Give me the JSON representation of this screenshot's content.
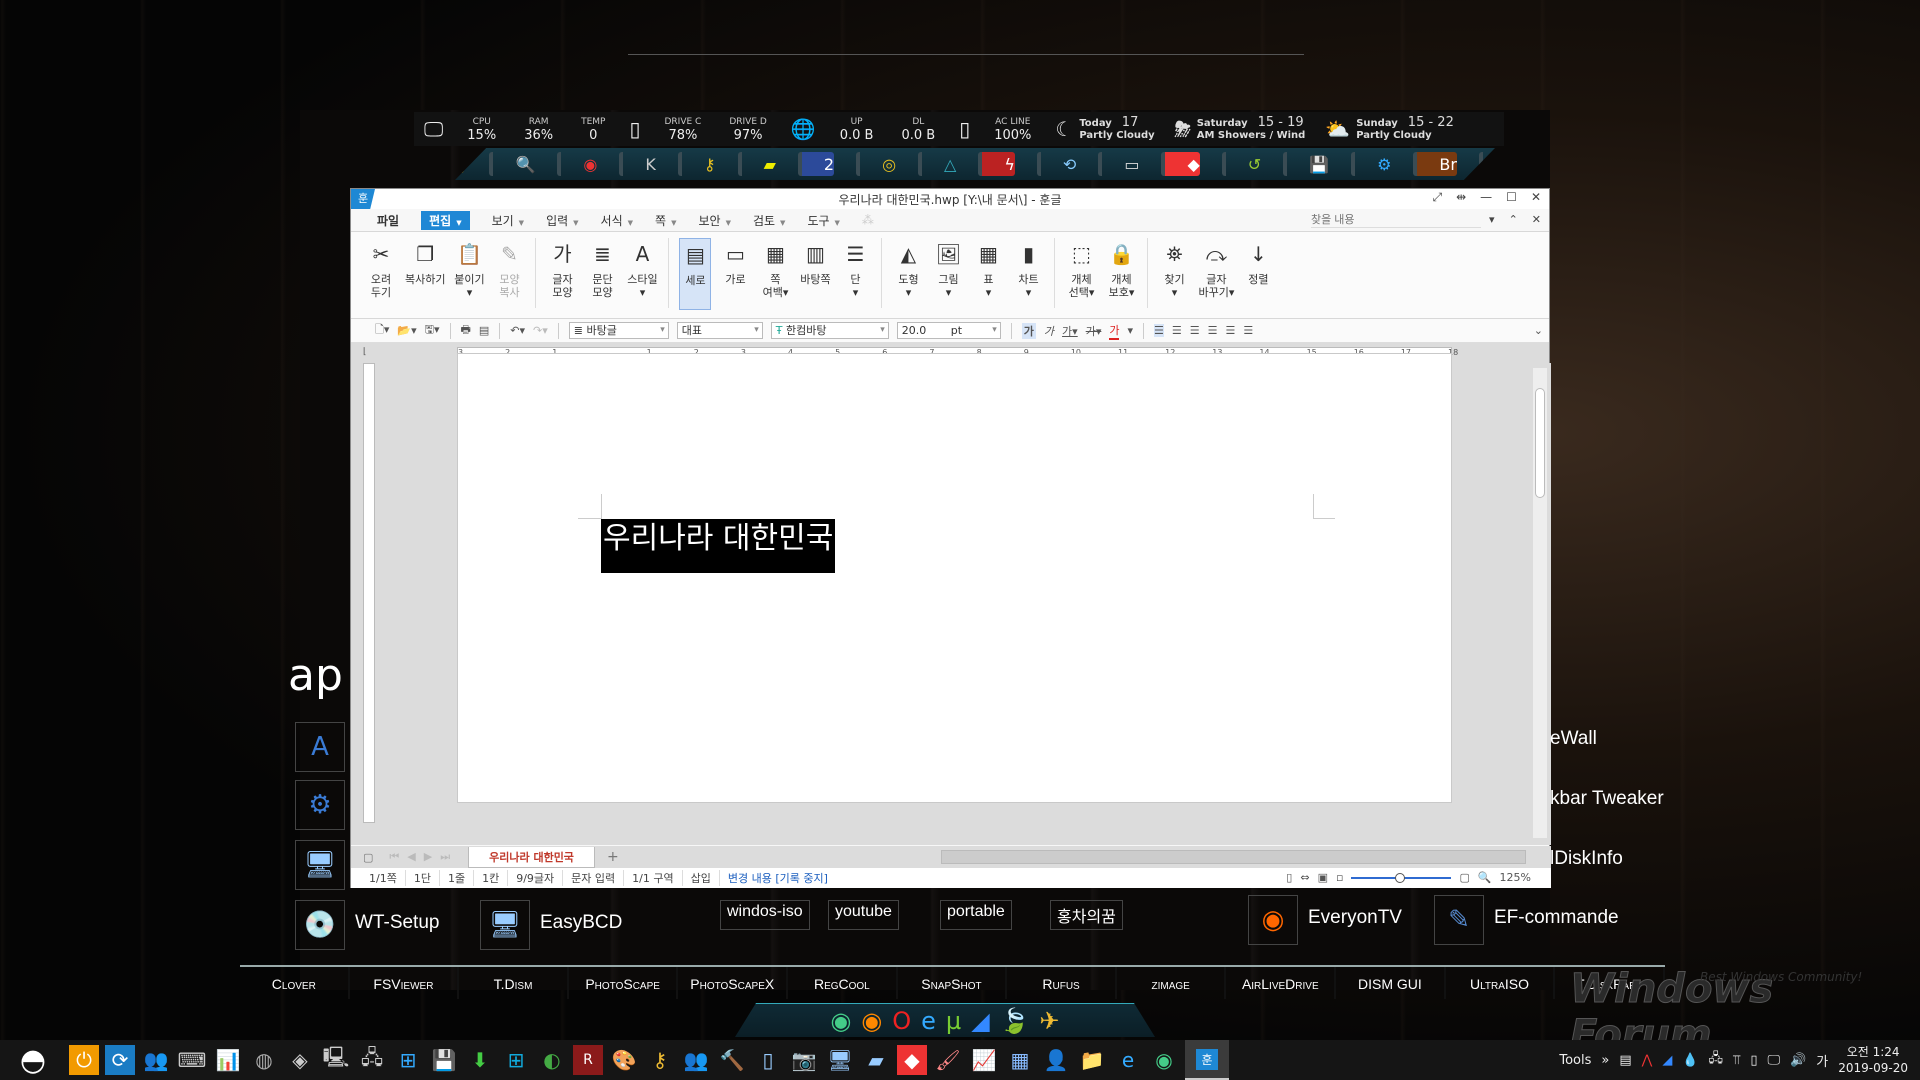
{
  "status_bar": {
    "cpu": {
      "label": "CPU",
      "value": "15%"
    },
    "ram": {
      "label": "RAM",
      "value": "36%"
    },
    "temp": {
      "label": "TEMP",
      "value": "0"
    },
    "drive_c": {
      "label": "DRIVE C",
      "value": "78%"
    },
    "drive_d": {
      "label": "DRIVE D",
      "value": "97%"
    },
    "up": {
      "label": "UP",
      "value": "0.0 B"
    },
    "dl": {
      "label": "DL",
      "value": "0.0 B"
    },
    "ac": {
      "label": "AC LINE",
      "value": "100%"
    },
    "weather": [
      {
        "day": "Today",
        "temp": "17",
        "desc": "Partly Cloudy",
        "icon": "moon-cloud-icon"
      },
      {
        "day": "Saturday",
        "temp": "15 - 19",
        "desc": "AM Showers / Wind",
        "icon": "sun-rain-icon"
      },
      {
        "day": "Sunday",
        "temp": "15 - 22",
        "desc": "Partly Cloudy",
        "icon": "sun-cloud-icon"
      }
    ]
  },
  "launcher_icons": [
    "internet-explorer-icon",
    "lock-gear-icon",
    "search-icon",
    "disk-refresh-icon",
    "k-icon",
    "key-icon",
    "pdf-icon",
    "number-2-icon",
    "disc-icon",
    "triangle-icon",
    "flash-icon",
    "backup-icon",
    "drive-icon",
    "anydesk-icon",
    "restore-icon",
    "floppy-icon",
    "gears-icon",
    "bridge-icon",
    "glove-icon",
    "settings-icon"
  ],
  "window": {
    "app_icon": "훈",
    "title": "우리나라 대한민국.hwp [Y:\\내 문서\\] - 훈글",
    "menu": [
      {
        "label": "파일"
      },
      {
        "label": "편집"
      },
      {
        "label": "보기"
      },
      {
        "label": "입력"
      },
      {
        "label": "서식"
      },
      {
        "label": "쪽"
      },
      {
        "label": "보안"
      },
      {
        "label": "검토"
      },
      {
        "label": "도구"
      }
    ],
    "search_placeholder": "찾을 내용",
    "ribbon": [
      {
        "label1": "오려",
        "label2": "두기",
        "icon": "✂"
      },
      {
        "label1": "복사하기",
        "label2": "",
        "icon": "❐"
      },
      {
        "label1": "붙이기",
        "label2": "▾",
        "icon": "📋"
      },
      {
        "label1": "모양",
        "label2": "복사",
        "icon": "✎"
      },
      {
        "label1": "글자",
        "label2": "모양",
        "icon": "가"
      },
      {
        "label1": "문단",
        "label2": "모양",
        "icon": "≣"
      },
      {
        "label1": "스타일",
        "label2": "▾",
        "icon": "A"
      },
      {
        "label1": "세로",
        "label2": "",
        "icon": "▤"
      },
      {
        "label1": "가로",
        "label2": "",
        "icon": "▭"
      },
      {
        "label1": "쪽",
        "label2": "여백▾",
        "icon": "▦"
      },
      {
        "label1": "바탕쪽",
        "label2": "",
        "icon": "▥"
      },
      {
        "label1": "단",
        "label2": "▾",
        "icon": "☰"
      },
      {
        "label1": "도형",
        "label2": "▾",
        "icon": "◭"
      },
      {
        "label1": "그림",
        "label2": "▾",
        "icon": "🖼"
      },
      {
        "label1": "표",
        "label2": "▾",
        "icon": "▦"
      },
      {
        "label1": "차트",
        "label2": "▾",
        "icon": "▮"
      },
      {
        "label1": "개체",
        "label2": "선택▾",
        "icon": "⬚"
      },
      {
        "label1": "개체",
        "label2": "보호▾",
        "icon": "🔒"
      },
      {
        "label1": "찾기",
        "label2": "▾",
        "icon": "⛯"
      },
      {
        "label1": "글자",
        "label2": "바꾸기▾",
        "icon": "⤼"
      },
      {
        "label1": "정렬",
        "label2": "",
        "icon": "↓"
      }
    ],
    "format": {
      "style": "바탕글",
      "lang": "대표",
      "font": "한컴바탕",
      "size": "20.0",
      "unit": "pt"
    },
    "ruler_ticks": [
      "3",
      "2",
      "1",
      "",
      "1",
      "2",
      "3",
      "4",
      "5",
      "6",
      "7",
      "8",
      "9",
      "10",
      "11",
      "12",
      "13",
      "14",
      "15",
      "16",
      "17",
      "18"
    ],
    "document_text": "우리나라 대한민국",
    "sheet_tab": "우리나라 대한민국",
    "status": {
      "page": "1/1쪽",
      "col": "1단",
      "line": "1줄",
      "pos": "1칸",
      "chars": "9/9글자",
      "mode": "문자 입력",
      "section": "1/1 구역",
      "insert": "삽입",
      "track": "변경 내용 [기록 중지]",
      "zoom": "125%"
    }
  },
  "desktop": {
    "apps_title": "ap",
    "shortcuts": [
      {
        "label": "WT-Setup"
      },
      {
        "label": "EasyBCD"
      },
      {
        "label": "EveryonTV"
      },
      {
        "label": "EF-commande"
      }
    ],
    "tiles": [
      "windos-iso",
      "youtube",
      "portable",
      "홍차의꿈"
    ],
    "right_labels": [
      "eWall",
      "kbar Tweaker",
      "lDiskInfo"
    ],
    "links": [
      "Clover",
      "FSViewer",
      "T.Dism",
      "PhotoScape",
      "PhotoScapeX",
      "RegCool",
      "SnapShot",
      "Rufus",
      "zimage",
      "AirLiveDrive",
      "DISM GUI",
      "UltraISO",
      "T.DiskPart"
    ],
    "watermark": "Windows Forum",
    "watermark_sub": "Best Windows Community!"
  },
  "taskbar": {
    "tools_label": "Tools",
    "ime": "가",
    "time": "오전 1:24",
    "date": "2019-09-20"
  }
}
